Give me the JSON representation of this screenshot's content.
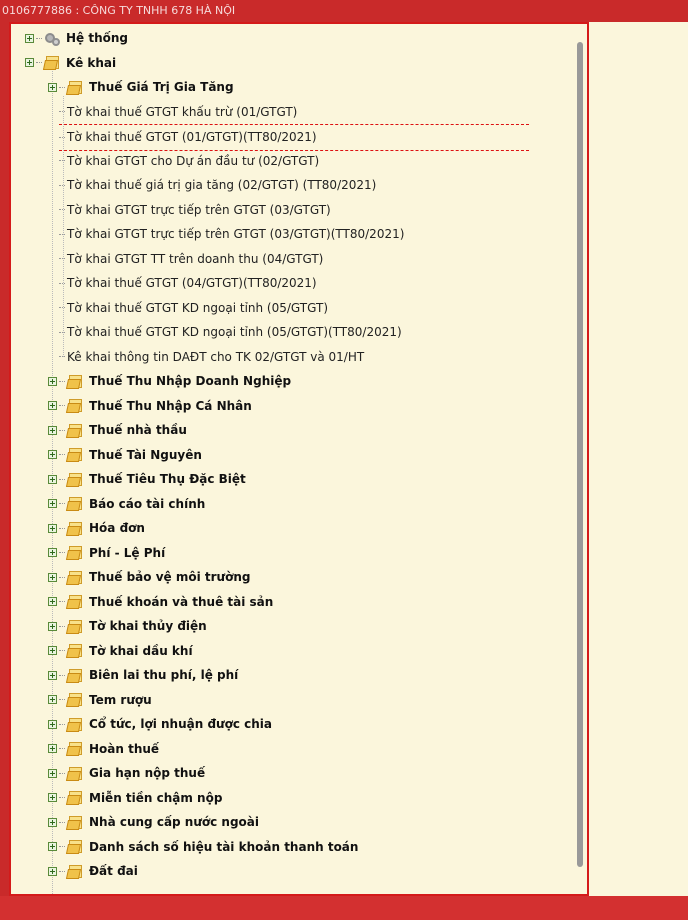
{
  "title": "0106777886 : CÔNG TY TNHH 678 HÀ NỘI",
  "tree": {
    "root_items": [
      {
        "label": "Hệ thống",
        "icon": "gear-icon"
      },
      {
        "label": "Kê khai",
        "icon": "folder-icon"
      }
    ],
    "vat_group": {
      "label": "Thuế Giá Trị Gia Tăng"
    },
    "vat_leaves": [
      "Tờ khai thuế GTGT khấu trừ (01/GTGT)",
      "Tờ khai thuế GTGT (01/GTGT)(TT80/2021)",
      "Tờ khai GTGT cho Dự án đầu tư (02/GTGT)",
      "Tờ khai thuế giá trị gia tăng (02/GTGT) (TT80/2021)",
      "Tờ khai GTGT trực tiếp trên GTGT (03/GTGT)",
      "Tờ khai GTGT trực tiếp trên GTGT (03/GTGT)(TT80/2021)",
      "Tờ khai GTGT TT trên doanh thu (04/GTGT)",
      "Tờ khai thuế GTGT (04/GTGT)(TT80/2021)",
      "Tờ khai thuế GTGT KD ngoại tỉnh (05/GTGT)",
      "Tờ khai thuế GTGT KD ngoại tỉnh (05/GTGT)(TT80/2021)",
      "Kê khai thông tin DAĐT cho TK 02/GTGT và 01/HT"
    ],
    "selected_leaf_index": 1,
    "groups": [
      "Thuế Thu Nhập Doanh Nghiệp",
      "Thuế Thu Nhập Cá Nhân",
      "Thuế nhà thầu",
      "Thuế Tài Nguyên",
      "Thuế Tiêu Thụ Đặc Biệt",
      "Báo cáo tài chính",
      "Hóa đơn",
      "Phí - Lệ Phí",
      "Thuế bảo vệ môi trường",
      "Thuế khoán và thuê tài sản",
      "Tờ khai thủy điện",
      "Tờ khai dầu khí",
      "Biên lai thu phí, lệ phí",
      "Tem rượu",
      "Cổ tức, lợi nhuận được chia",
      "Hoàn thuế",
      "Gia hạn nộp thuế",
      "Miễn tiền chậm nộp",
      "Nhà cung cấp nước ngoài",
      "Danh sách số hiệu tài khoản thanh toán",
      "Đất đai"
    ]
  },
  "colors": {
    "frame": "#c92a2a",
    "panel_bg": "#fbf6dc",
    "border": "#d41a1a",
    "selection_dash": "#d11111"
  }
}
